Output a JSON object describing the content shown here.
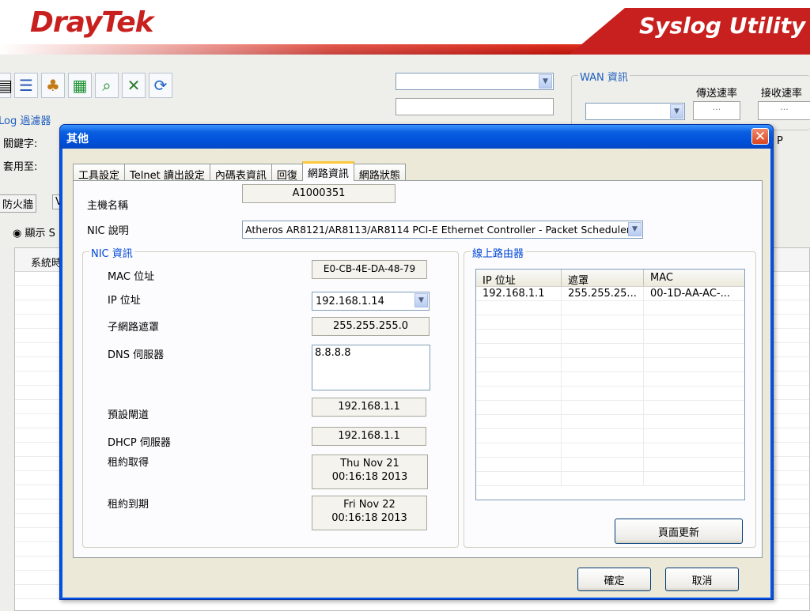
{
  "brand": {
    "logo_left": "DrayTek",
    "logo_right": "Syslog Utility"
  },
  "background": {
    "wan_legend": "WAN 資訊",
    "tx_rate_label": "傳送速率",
    "rx_rate_label": "接收速率",
    "ellipsis": "...",
    "log_filter_label": "Log 過濾器",
    "keyword_label": "關鍵字:",
    "apply_to_label": "套用至:",
    "tab_firewall": "防火牆",
    "tab_partial": "V",
    "radio_show": "顯示 S",
    "list_header_time": "系統時",
    "partial_p": "P"
  },
  "dialog": {
    "title": "其他",
    "close_glyph": "✕",
    "tabs": [
      "工具設定",
      "Telnet 讀出設定",
      "內碼表資訊",
      "回復",
      "網路資訊",
      "網路狀態"
    ],
    "active_tab_index": 4,
    "hostname_label": "主機名稱",
    "hostname_value": "A1000351",
    "nic_desc_label": "NIC 說明",
    "nic_desc_value": "Atheros AR8121/AR8113/AR8114 PCI-E Ethernet Controller - Packet Scheduler",
    "nic_info_legend": "NIC 資訊",
    "mac_label": "MAC 位址",
    "mac_value": "E0-CB-4E-DA-48-79",
    "ip_label": "IP 位址",
    "ip_value": "192.168.1.14",
    "subnet_label": "子網路遮罩",
    "subnet_value": "255.255.255.0",
    "dns_label": "DNS 伺服器",
    "dns_value": "8.8.8.8",
    "gateway_label": "預設閘道",
    "gateway_value": "192.168.1.1",
    "dhcp_label": "DHCP 伺服器",
    "dhcp_value": "192.168.1.1",
    "lease_obtained_label": "租約取得",
    "lease_obtained_value": "Thu Nov 21 00:16:18 2013",
    "lease_expires_label": "租約到期",
    "lease_expires_value": "Fri Nov 22 00:16:18 2013",
    "online_router_legend": "線上路由器",
    "router_table": {
      "columns": [
        "IP 位址",
        "遮罩",
        "MAC"
      ],
      "rows": [
        [
          "192.168.1.1",
          "255.255.25...",
          "00-1D-AA-AC-..."
        ]
      ]
    },
    "refresh_button": "頁面更新",
    "ok_button": "確定",
    "cancel_button": "取消"
  },
  "colors": {
    "brand_red": "#c8201e",
    "title_bar_blue": "#0055e5",
    "legend_blue": "#0046d5",
    "dialog_bg": "#ece9d8"
  }
}
